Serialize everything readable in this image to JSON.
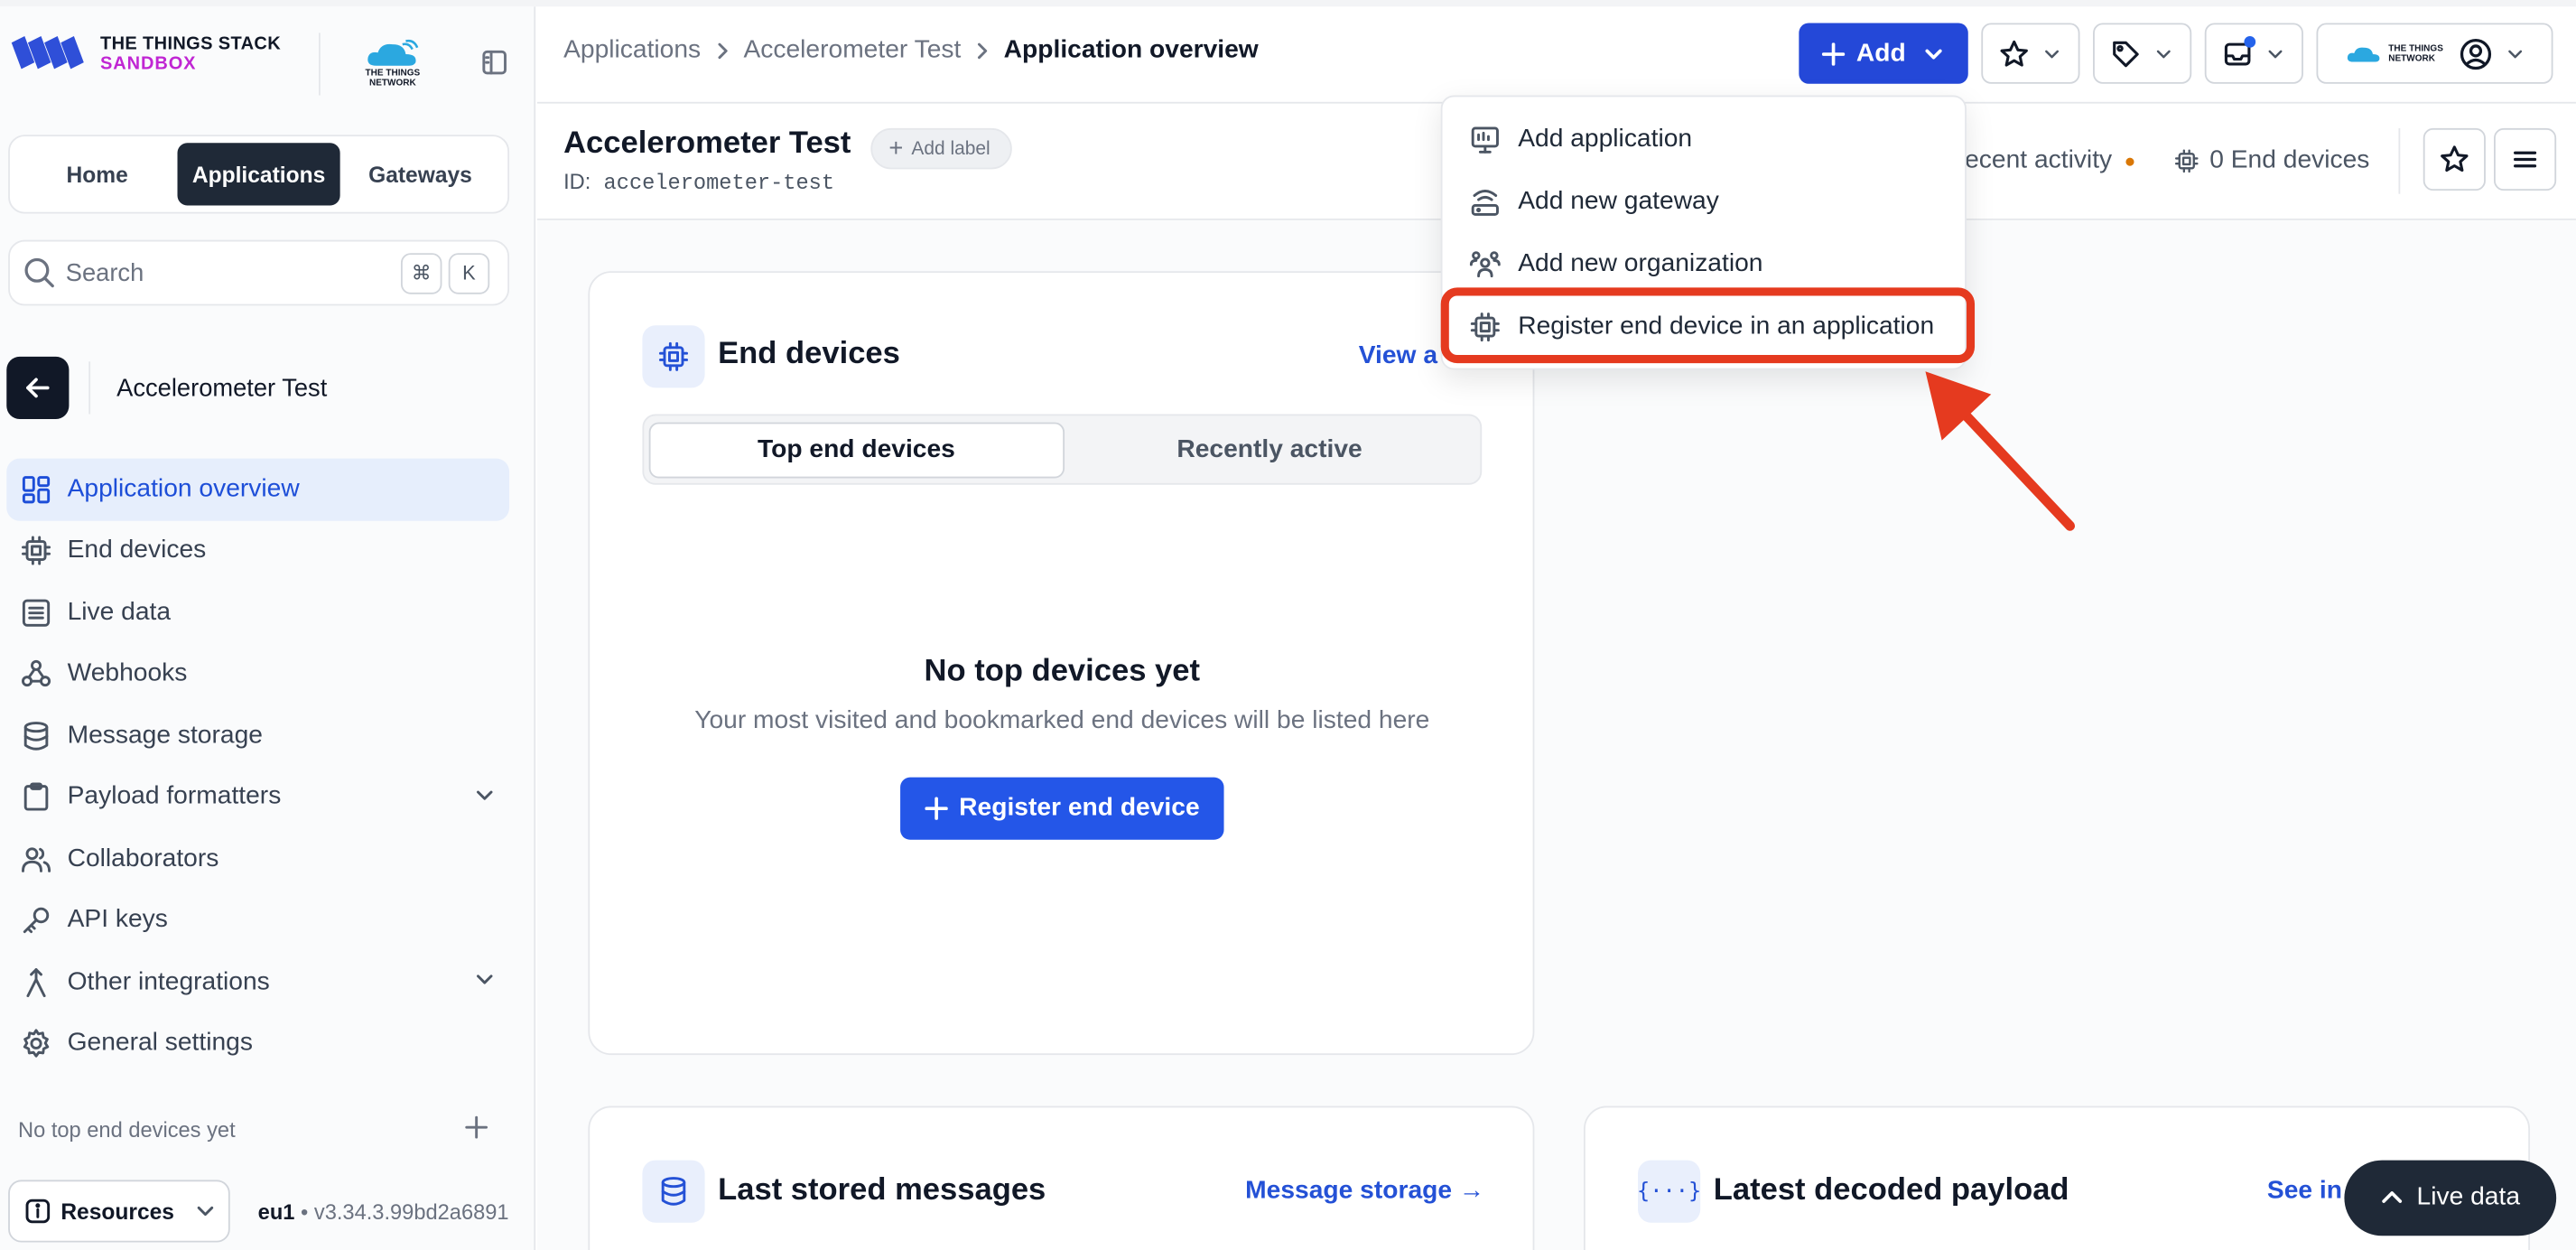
{
  "brand": {
    "line1": "THE THINGS STACK",
    "line2": "SANDBOX",
    "network_line1": "THE THINGS",
    "network_line2": "NETWORK"
  },
  "nav_tabs": [
    {
      "label": "Home",
      "active": false
    },
    {
      "label": "Applications",
      "active": true
    },
    {
      "label": "Gateways",
      "active": false
    }
  ],
  "search": {
    "placeholder": "Search",
    "shortcut_mod": "⌘",
    "shortcut_key": "K"
  },
  "app_context": {
    "name": "Accelerometer Test"
  },
  "sidebar": {
    "items": [
      {
        "label": "Application overview",
        "icon": "overview-icon",
        "active": true
      },
      {
        "label": "End devices",
        "icon": "chip-icon"
      },
      {
        "label": "Live data",
        "icon": "list-icon"
      },
      {
        "label": "Webhooks",
        "icon": "webhook-icon"
      },
      {
        "label": "Message storage",
        "icon": "database-icon"
      },
      {
        "label": "Payload formatters",
        "icon": "clipboard-icon",
        "expandable": true
      },
      {
        "label": "Collaborators",
        "icon": "users-icon"
      },
      {
        "label": "API keys",
        "icon": "key-icon"
      },
      {
        "label": "Other integrations",
        "icon": "integration-icon",
        "expandable": true
      },
      {
        "label": "General settings",
        "icon": "gear-icon"
      }
    ],
    "empty_text": "No top end devices yet",
    "resources_label": "Resources",
    "cluster": "eu1",
    "version": "v3.34.3.99bd2a6891"
  },
  "breadcrumb": {
    "items": [
      "Applications",
      "Accelerometer Test"
    ],
    "current": "Application overview"
  },
  "header": {
    "add_label": "Add"
  },
  "page": {
    "title": "Accelerometer Test",
    "add_label": "Add label",
    "id_label": "ID:",
    "id_value": "accelerometer-test",
    "recent_activity": "ecent activity",
    "end_devices_count": "0 End devices"
  },
  "add_menu": {
    "items": [
      {
        "label": "Add application",
        "icon": "monitor-icon"
      },
      {
        "label": "Add new gateway",
        "icon": "gateway-icon"
      },
      {
        "label": "Add new organization",
        "icon": "organization-icon"
      },
      {
        "label": "Register end device in an application",
        "icon": "chip-icon",
        "highlighted": true
      }
    ]
  },
  "end_devices_card": {
    "title": "End devices",
    "view_all": "View a",
    "tabs": [
      {
        "label": "Top end devices",
        "active": true
      },
      {
        "label": "Recently active",
        "active": false
      }
    ],
    "empty_title": "No top devices yet",
    "empty_desc": "Your most visited and bookmarked end devices will be listed here",
    "register_label": "Register end device"
  },
  "messages_card": {
    "title": "Last stored messages",
    "link": "Message storage →"
  },
  "payload_card": {
    "title": "Latest decoded payload",
    "link": "See in"
  },
  "live_data": {
    "label": "Live data"
  },
  "colors": {
    "primary": "#2448d8",
    "dark": "#1f2937",
    "highlight": "#e53a1f",
    "active_bg": "#e6eefc"
  }
}
